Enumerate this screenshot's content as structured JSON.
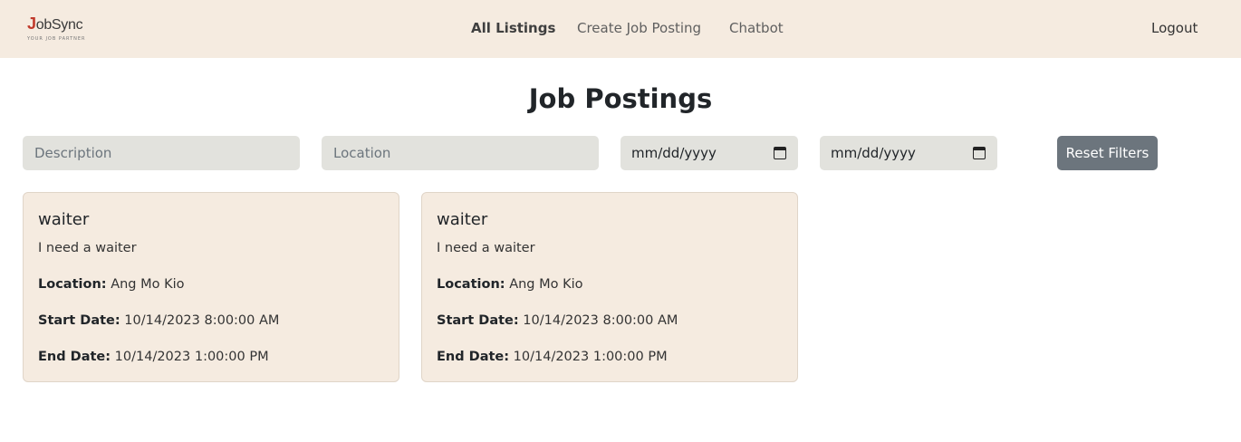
{
  "brand": {
    "name_initial": "J",
    "name_rest": "obSync",
    "tagline": "YOUR JOB PARTNER"
  },
  "nav": {
    "all_listings": "All Listings",
    "create_job_posting": "Create Job Posting",
    "chatbot": "Chatbot",
    "logout": "Logout"
  },
  "page": {
    "title": "Job Postings"
  },
  "filters": {
    "description_placeholder": "Description",
    "location_placeholder": "Location",
    "start_date_value": "mm/dd/yyyy",
    "end_date_value": "mm/dd/yyyy",
    "reset_label": "Reset Filters"
  },
  "labels": {
    "location": "Location:",
    "start_date": "Start Date:",
    "end_date": "End Date:"
  },
  "jobs": [
    {
      "title": "waiter",
      "description": "I need a waiter",
      "location": "Ang Mo Kio",
      "start": "10/14/2023 8:00:00 AM",
      "end": "10/14/2023 1:00:00 PM"
    },
    {
      "title": "waiter",
      "description": "I need a waiter",
      "location": "Ang Mo Kio",
      "start": "10/14/2023 8:00:00 AM",
      "end": "10/14/2023 1:00:00 PM"
    }
  ],
  "colors": {
    "navbar_bg": "#f5ebe0",
    "card_bg": "#f5ebe0",
    "reset_button": "#6c757d",
    "logo_accent": "#c0392b"
  }
}
